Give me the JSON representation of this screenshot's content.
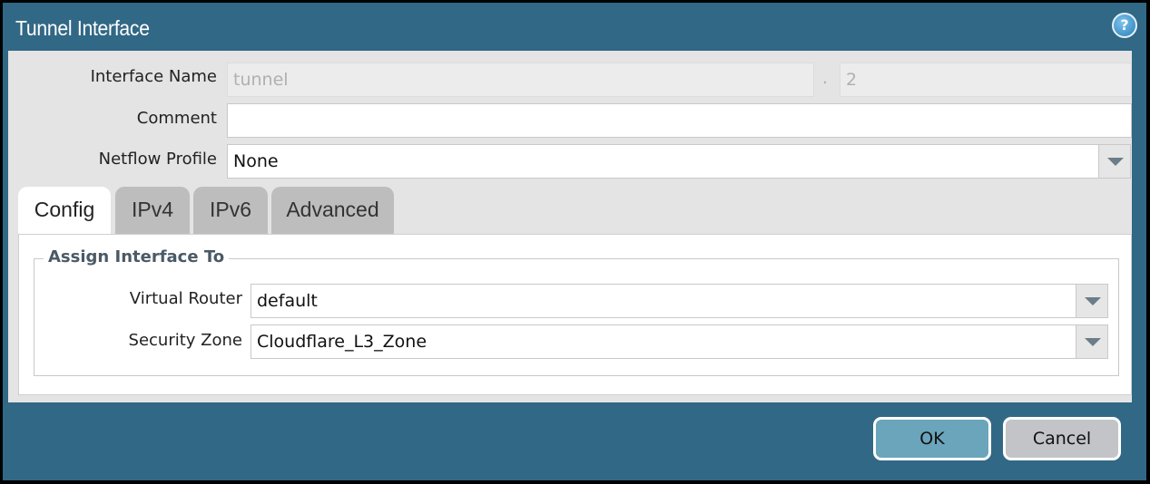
{
  "dialog": {
    "title": "Tunnel Interface",
    "help_icon": "question-circle-icon",
    "help_glyph": "?"
  },
  "fields": {
    "interface_name": {
      "label": "Interface Name",
      "value": "tunnel",
      "separator": ".",
      "suffix": "2"
    },
    "comment": {
      "label": "Comment",
      "value": ""
    },
    "netflow_profile": {
      "label": "Netflow Profile",
      "value": "None"
    }
  },
  "tabs": [
    {
      "label": "Config",
      "active": true
    },
    {
      "label": "IPv4",
      "active": false
    },
    {
      "label": "IPv6",
      "active": false
    },
    {
      "label": "Advanced",
      "active": false
    }
  ],
  "assign": {
    "legend": "Assign Interface To",
    "virtual_router": {
      "label": "Virtual Router",
      "value": "default"
    },
    "security_zone": {
      "label": "Security Zone",
      "value": "Cloudflare_L3_Zone"
    }
  },
  "buttons": {
    "ok": "OK",
    "cancel": "Cancel"
  },
  "colors": {
    "frame": "#316886",
    "ok_button": "#6aa5bb",
    "cancel_button": "#c2c4c8"
  }
}
